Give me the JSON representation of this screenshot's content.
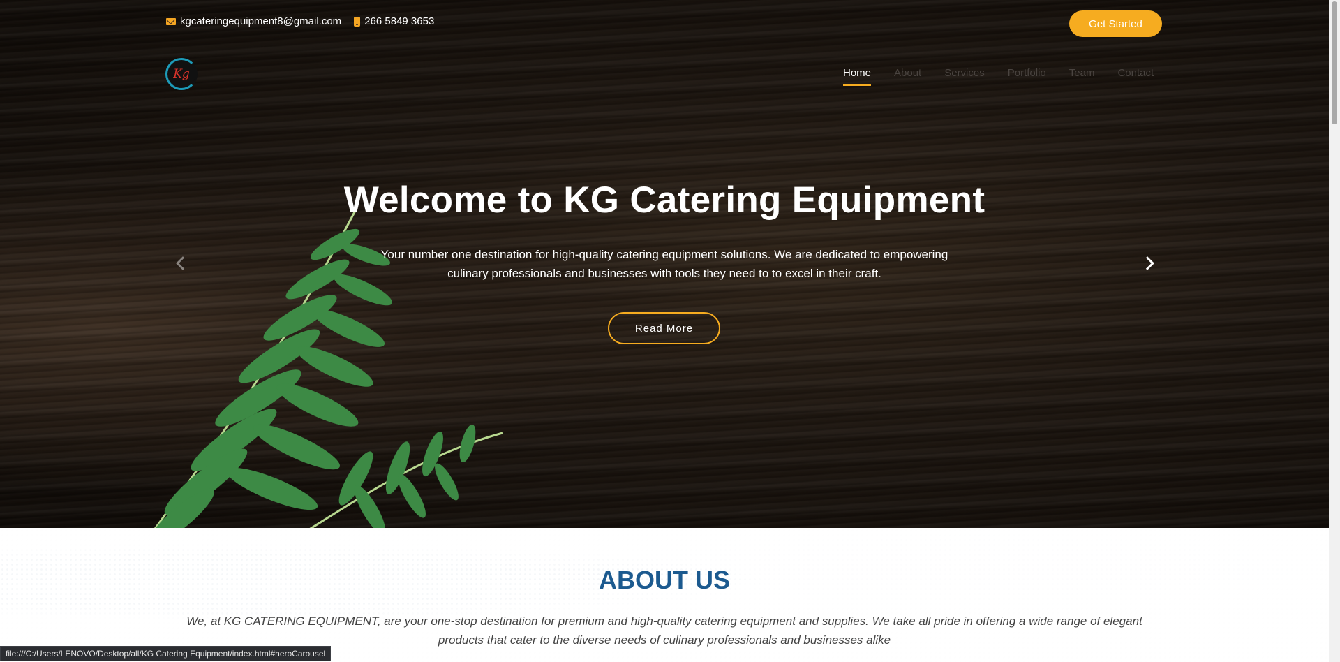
{
  "topbar": {
    "email": "kgcateringequipment8@gmail.com",
    "phone": "266 5849 3653",
    "email_icon": "envelope-icon",
    "phone_icon": "phone-icon",
    "cta_label": "Get Started"
  },
  "logo": {
    "text": "Kg"
  },
  "nav": {
    "items": [
      {
        "label": "Home",
        "active": true
      },
      {
        "label": "About"
      },
      {
        "label": "Services"
      },
      {
        "label": "Portfolio"
      },
      {
        "label": "Team"
      },
      {
        "label": "Contact"
      }
    ]
  },
  "hero": {
    "title": "Welcome to KG Catering Equipment",
    "text": "Your number one destination for high-quality catering equipment solutions. We are dedicated to empowering culinary professionals and businesses with tools they need to to excel in their craft.",
    "button_label": "Read More",
    "prev_icon": "chevron-left-icon",
    "next_icon": "chevron-right-icon"
  },
  "about": {
    "title": "ABOUT US",
    "text": "We, at KG CATERING EQUIPMENT, are your one-stop destination for premium and high-quality catering equipment and supplies. We take all pride in offering a wide range of elegant products that cater to the diverse needs of culinary professionals and businesses alike"
  },
  "statusbar": {
    "url": "file:///C:/Users/LENOVO/Desktop/all/KG Catering Equipment/index.html#heroCarousel"
  },
  "colors": {
    "accent": "#f6ac20",
    "about_title": "#1c5a8f"
  }
}
